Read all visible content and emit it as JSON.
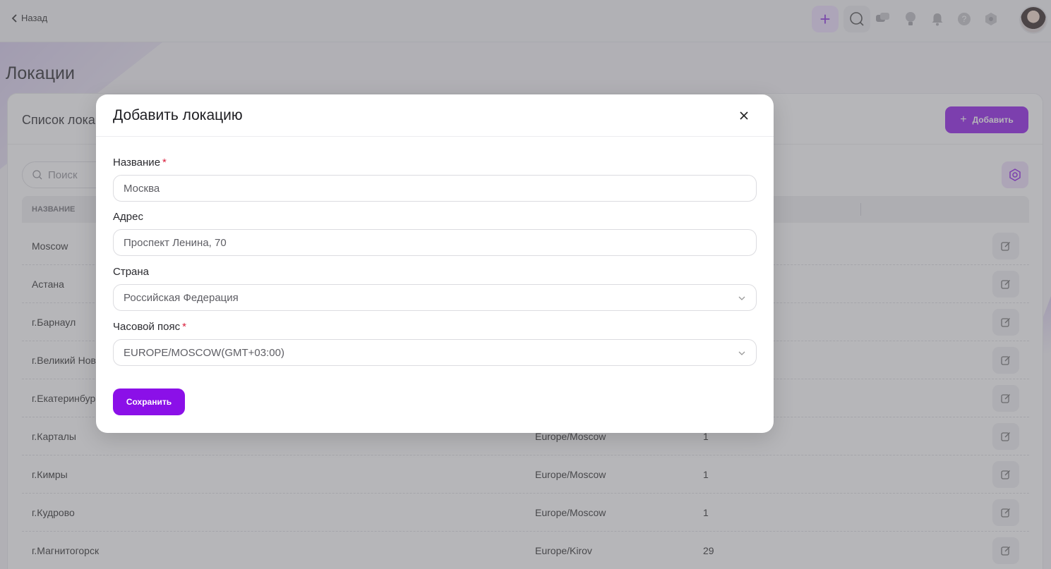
{
  "topbar": {
    "back_label": "Назад"
  },
  "page": {
    "title": "Локации"
  },
  "card": {
    "title": "Список локаций",
    "add_label": "Добавить",
    "search_placeholder": "Поиск"
  },
  "table": {
    "header_name": "НАЗВАНИЕ",
    "rows": [
      {
        "name": "Moscow",
        "tz": "",
        "count": ""
      },
      {
        "name": "Астана",
        "tz": "",
        "count": ""
      },
      {
        "name": "г.Барнаул",
        "tz": "",
        "count": ""
      },
      {
        "name": "г.Великий Новгород",
        "tz": "",
        "count": ""
      },
      {
        "name": "г.Екатеринбург",
        "tz": "",
        "count": ""
      },
      {
        "name": "г.Карталы",
        "tz": "Europe/Moscow",
        "count": "1"
      },
      {
        "name": "г.Кимры",
        "tz": "Europe/Moscow",
        "count": "1"
      },
      {
        "name": "г.Кудрово",
        "tz": "Europe/Moscow",
        "count": "1"
      },
      {
        "name": "г.Магнитогорск",
        "tz": "Europe/Kirov",
        "count": "29"
      }
    ]
  },
  "modal": {
    "title": "Добавить локацию",
    "name_label": "Название",
    "name_value": "Москва",
    "address_label": "Адрес",
    "address_value": "Проспект Ленина, 70",
    "country_label": "Страна",
    "country_value": "Российская Федерация",
    "timezone_label": "Часовой пояс",
    "timezone_value": "EUROPE/MOSCOW(GMT+03:00)",
    "required_mark": "*",
    "save_label": "Сохранить"
  },
  "colors": {
    "accent": "#8b10e8",
    "required": "#d91f3c"
  }
}
